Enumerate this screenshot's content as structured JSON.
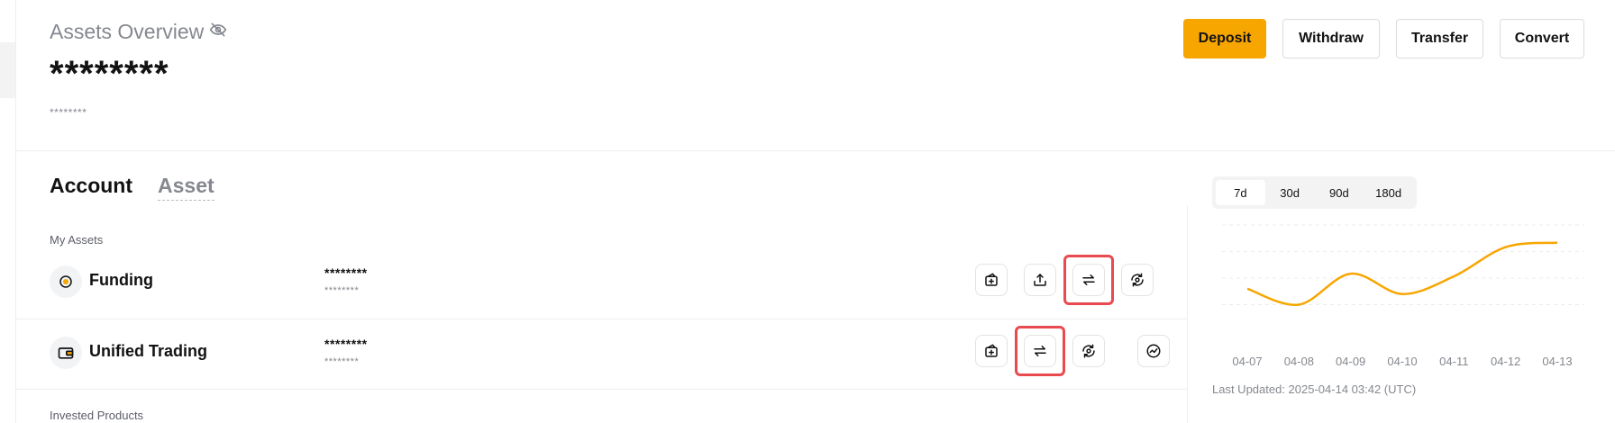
{
  "overview": {
    "title": "Assets Overview",
    "title_icon": "eye-off-icon",
    "balance_masked": "********",
    "balance_sub_masked": "********"
  },
  "actions": {
    "deposit": "Deposit",
    "withdraw": "Withdraw",
    "transfer": "Transfer",
    "convert": "Convert"
  },
  "tabs": {
    "account": "Account",
    "asset": "Asset"
  },
  "sections": {
    "my_assets": "My Assets",
    "invested_products": "Invested Products"
  },
  "accounts": [
    {
      "name": "Funding",
      "icon": "coin-icon",
      "balance_masked": "********",
      "balance_sub_masked": "********",
      "actions": [
        "deposit-icon",
        "withdraw-icon",
        "transfer-icon",
        "convert-icon"
      ],
      "highlighted_action": "transfer-icon"
    },
    {
      "name": "Unified Trading",
      "icon": "wallet-icon",
      "balance_masked": "********",
      "balance_sub_masked": "********",
      "actions": [
        "deposit-icon",
        "transfer-icon",
        "convert-icon",
        "trade-icon"
      ],
      "highlighted_action": "transfer-icon"
    }
  ],
  "chart": {
    "ranges": [
      "7d",
      "30d",
      "90d",
      "180d"
    ],
    "active_range": "7d",
    "last_updated": "Last Updated: 2025-04-14 03:42 (UTC)"
  },
  "colors": {
    "accent": "#f7a600",
    "highlight": "#e84a4f",
    "line": "#f7a600",
    "muted_text": "#85888f"
  },
  "chart_data": {
    "type": "line",
    "title": "",
    "xlabel": "",
    "ylabel": "",
    "x": [
      "04-07",
      "04-08",
      "04-09",
      "04-10",
      "04-11",
      "04-12",
      "04-13"
    ],
    "values": [
      0.48,
      0.3,
      0.65,
      0.42,
      0.62,
      0.95,
      1.0
    ],
    "grid": true,
    "ylim": [
      0,
      1.2
    ]
  }
}
